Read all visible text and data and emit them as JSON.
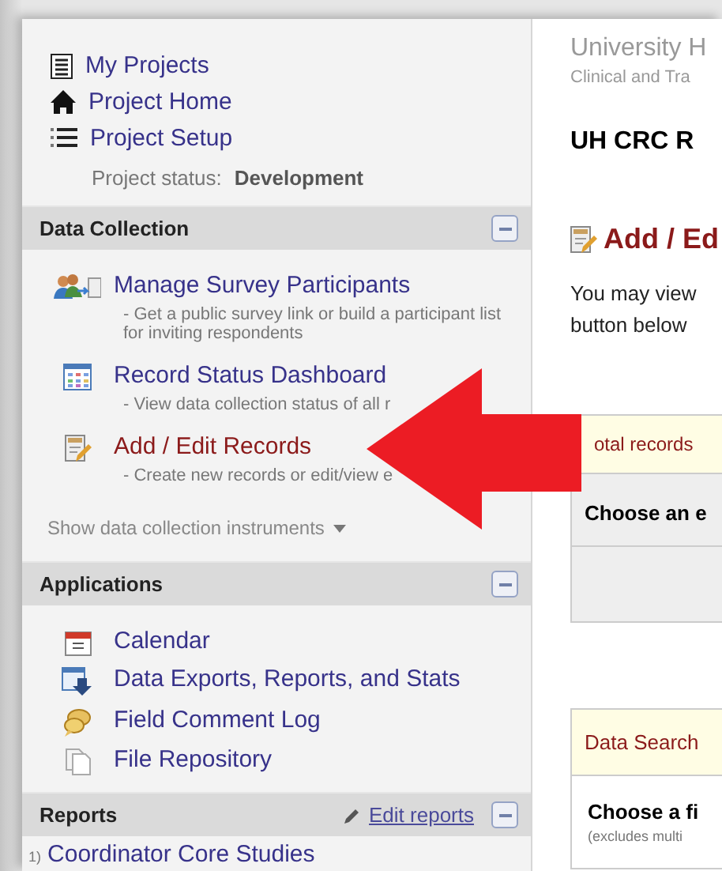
{
  "menu": {
    "items": [
      {
        "label": "My Projects"
      },
      {
        "label": "Project Home"
      },
      {
        "label": "Project Setup"
      }
    ],
    "status_label": "Project status:",
    "status_value": "Development"
  },
  "sections": [
    {
      "title": "Data Collection",
      "items": [
        {
          "label": "Manage Survey Participants",
          "description": "- Get a public survey link or build a participant list for inviting respondents",
          "selected": false
        },
        {
          "label": "Record Status Dashboard",
          "description": "- View data collection status of all r",
          "selected": false
        },
        {
          "label": "Add / Edit Records",
          "description": "- Create new records or edit/view e",
          "selected": true
        }
      ],
      "more_link": "Show data collection instruments"
    },
    {
      "title": "Applications",
      "items": [
        {
          "label": "Calendar",
          "selected": false
        },
        {
          "label": "Data Exports, Reports, and Stats",
          "selected": false
        },
        {
          "label": "Field Comment Log",
          "selected": false
        },
        {
          "label": "File Repository",
          "selected": false
        }
      ]
    },
    {
      "title": "Reports",
      "edit_link": "Edit reports",
      "reports": [
        {
          "number": "1)",
          "label": "Coordinator Core Studies"
        }
      ]
    }
  ],
  "main": {
    "org_name": "University H",
    "org_sub": "Clinical and Tra",
    "project_title": "UH CRC R",
    "page_title": "Add / Ed",
    "intro_lines": [
      "You may view",
      "button below"
    ],
    "records_panel": {
      "notice": "otal records",
      "header": "Choose an e"
    },
    "search_panel": {
      "header": "Data Search",
      "label": "Choose a fi",
      "note": "(excludes multi"
    }
  }
}
